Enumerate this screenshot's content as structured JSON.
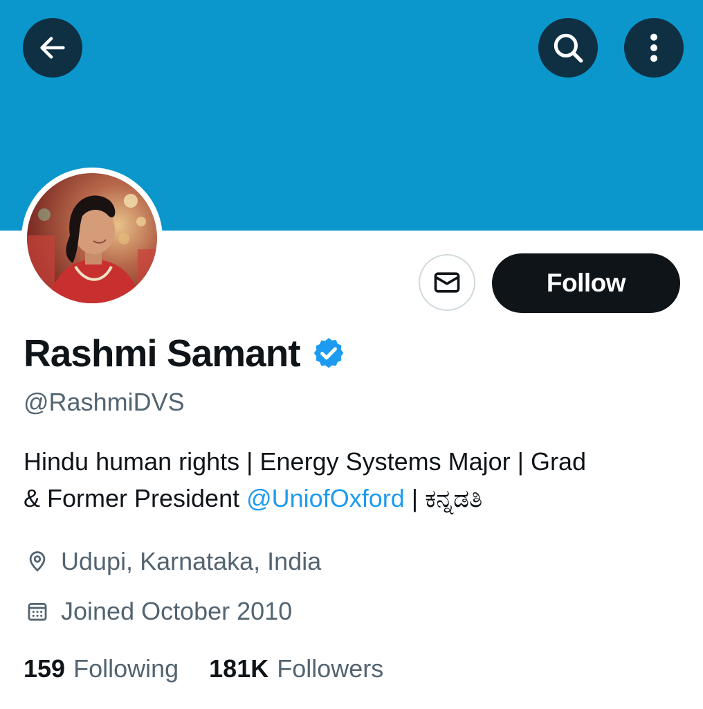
{
  "header": {
    "banner_color": "#0b97cc",
    "back_icon": "arrow-left-icon",
    "search_icon": "search-icon",
    "more_icon": "more-vertical-icon"
  },
  "profile": {
    "name": "Rashmi Samant",
    "verified_icon": "verified-badge-icon",
    "handle": "@RashmiDVS",
    "bio_line1": "Hindu human rights | Energy Systems Major | Grad",
    "bio_line2_prefix": "& Former President ",
    "bio_mention": "@UniofOxford",
    "bio_line2_suffix": " | ಕನ್ನಡತಿ",
    "location": "Udupi, Karnataka, India",
    "joined": "Joined October 2010"
  },
  "actions": {
    "message_icon": "envelope-icon",
    "follow_label": "Follow"
  },
  "stats": {
    "following_count": "159",
    "following_label": "Following",
    "followers_count": "181K",
    "followers_label": "Followers"
  },
  "colors": {
    "accent": "#1d9bf0",
    "button_dark": "#0f1419",
    "muted_text": "#536471"
  }
}
